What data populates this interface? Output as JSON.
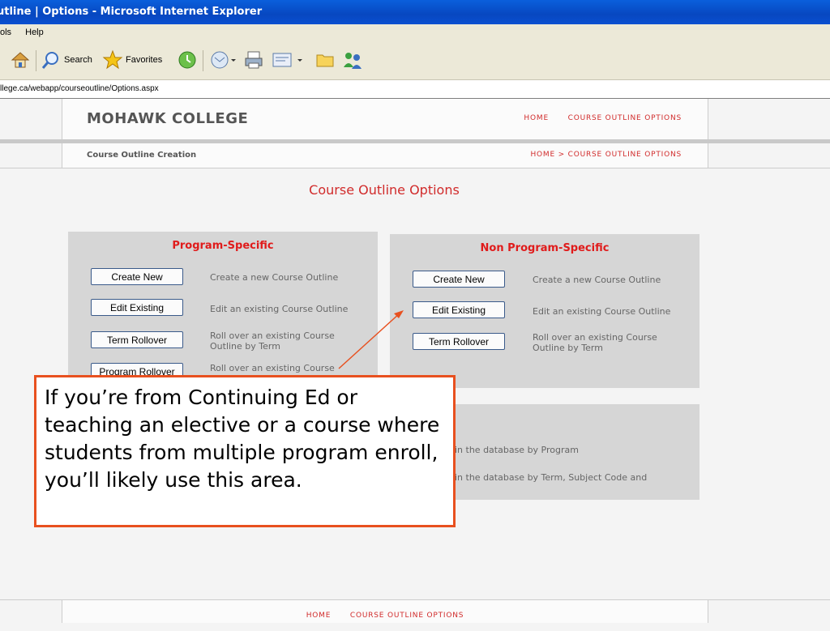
{
  "browser": {
    "title": "utline | Options - Microsoft Internet Explorer",
    "menu": [
      "ols",
      "Help"
    ],
    "toolbar": {
      "search": "Search",
      "favorites": "Favorites"
    },
    "address": "llege.ca/webapp/courseoutline/Options.aspx"
  },
  "site": {
    "logo": "MOHAWK COLLEGE",
    "nav": [
      "HOME",
      "COURSE OUTLINE OPTIONS"
    ],
    "crumb_title": "Course Outline Creation",
    "crumb_path": "HOME > COURSE OUTLINE OPTIONS"
  },
  "page": {
    "title": "Course Outline Options"
  },
  "program_specific": {
    "heading": "Program-Specific",
    "rows": [
      {
        "button": "Create New",
        "desc": "Create a new Course Outline"
      },
      {
        "button": "Edit Existing",
        "desc": "Edit an existing Course Outline"
      },
      {
        "button": "Term Rollover",
        "desc": "Roll over an existing Course Outline by Term"
      },
      {
        "button": "Program Rollover",
        "desc": "Roll over an existing Course"
      }
    ]
  },
  "non_program_specific": {
    "heading": "Non Program-Specific",
    "rows": [
      {
        "button": "Create New",
        "desc": "Create a new Course Outline"
      },
      {
        "button": "Edit Existing",
        "desc": "Edit an existing Course Outline"
      },
      {
        "button": "Term Rollover",
        "desc": "Roll over an existing Course Outline by Term"
      }
    ]
  },
  "search_panel": {
    "lines": [
      "in the database by Program",
      "in the database by Term, Subject Code and"
    ]
  },
  "callout": {
    "text": "If you’re from Continuing Ed or teaching an elective or a course where students from multiple program enroll, you’ll likely use this area.",
    "border_color": "#e8501f"
  },
  "footer": {
    "nav": [
      "HOME",
      "COURSE OUTLINE OPTIONS"
    ]
  },
  "colors": {
    "accent": "#d12b2b",
    "panel": "#d6d6d6"
  }
}
